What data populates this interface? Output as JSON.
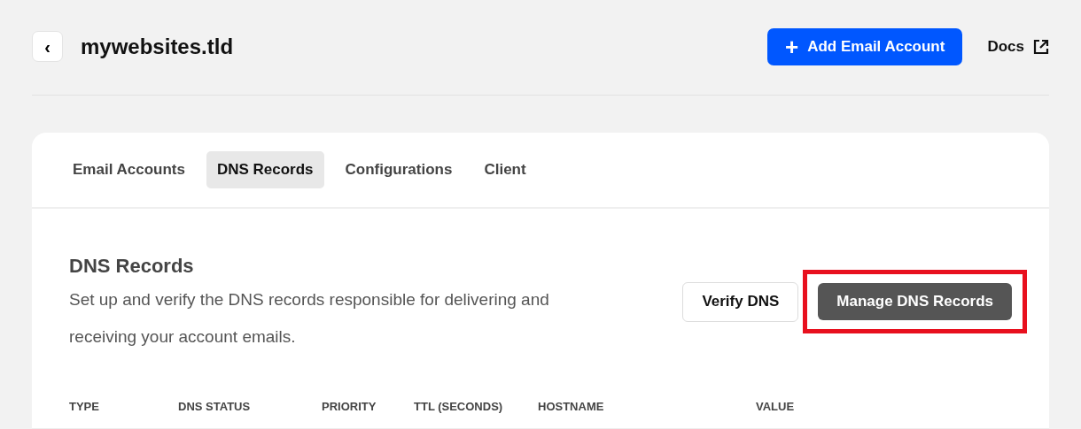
{
  "header": {
    "back_button": "‹",
    "title": "mywebsites.tld",
    "add_button": {
      "icon": "+",
      "label": "Add Email Account"
    },
    "docs_link": "Docs"
  },
  "tabs": [
    {
      "label": "Email Accounts",
      "selected": false
    },
    {
      "label": "DNS Records",
      "selected": true
    },
    {
      "label": "Configurations",
      "selected": false
    },
    {
      "label": "Client",
      "selected": false
    }
  ],
  "section": {
    "title": "DNS Records",
    "description": "Set up and verify the DNS records responsible for delivering and receiving your account emails.",
    "buttons": [
      {
        "label": "Verify DNS",
        "kind": "secondary",
        "highlighted": false
      },
      {
        "label": "Manage DNS Records",
        "kind": "primary",
        "highlighted": true
      }
    ]
  },
  "table": {
    "columns": [
      "TYPE",
      "DNS STATUS",
      "PRIORITY",
      "TTL (SECONDS)",
      "HOSTNAME",
      "VALUE"
    ]
  }
}
